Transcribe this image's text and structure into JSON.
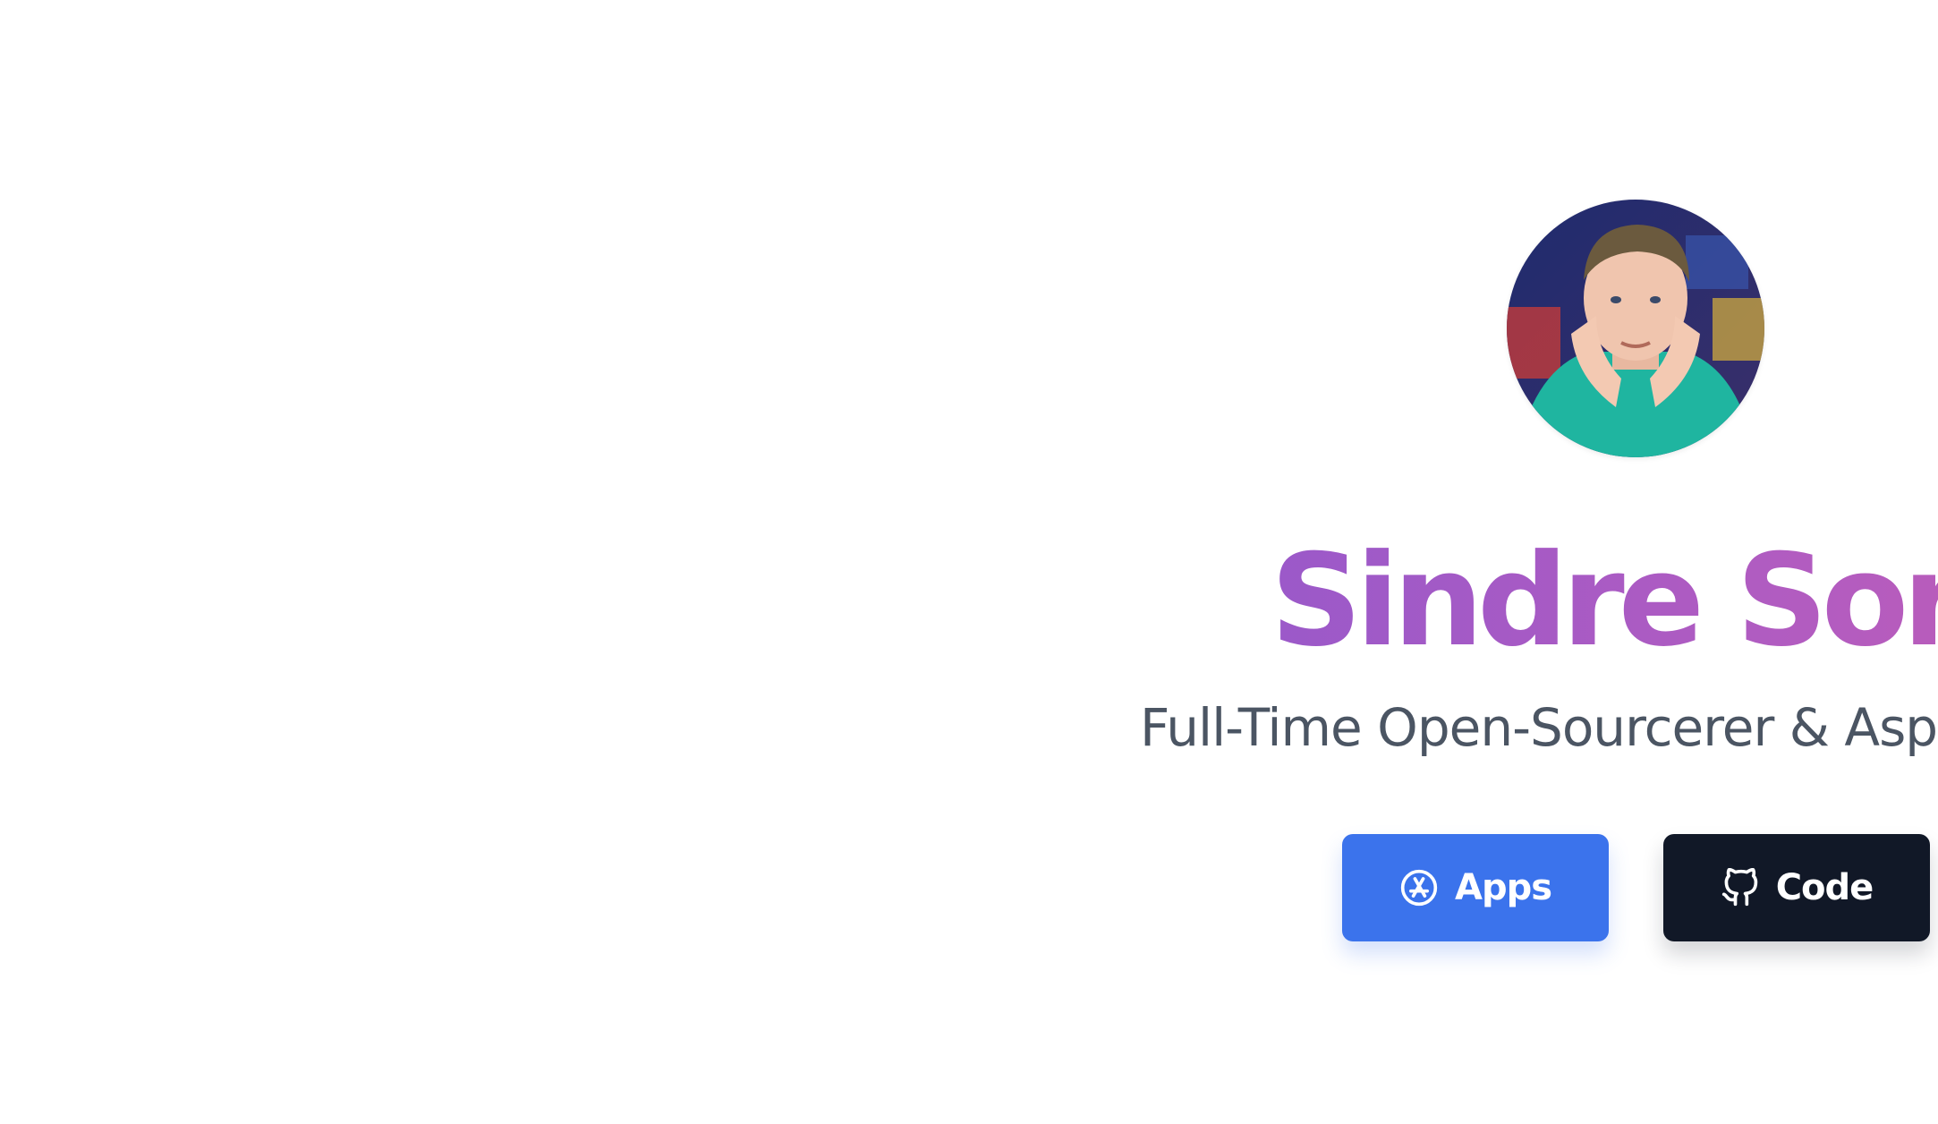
{
  "profile": {
    "name": "Sindre Sorhus",
    "tagline": "Full-Time Open-Sourcerer & Aspiring Rubyist"
  },
  "buttons": {
    "apps_label": "Apps",
    "code_label": "Code"
  },
  "icons": {
    "apps": "app-store-icon",
    "code": "github-icon"
  },
  "colors": {
    "name_gradient_start": "#9b59c9",
    "name_gradient_end": "#c25bb0",
    "tagline": "#4b5563",
    "apps_button": "#3b73ec",
    "code_button": "#111827"
  }
}
